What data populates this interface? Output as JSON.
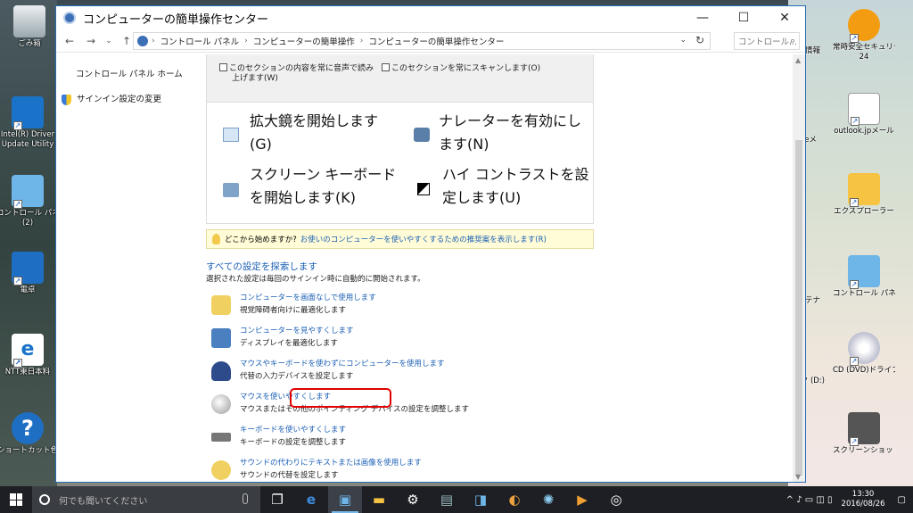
{
  "window": {
    "title": "コンピューターの簡単操作センター",
    "minimize": "—",
    "maximize": "☐",
    "close": "✕"
  },
  "addressbar": {
    "back": "←",
    "forward": "→",
    "dropdown": "⌄",
    "up": "↑",
    "crumbs": [
      "コントロール パネル",
      "コンピューターの簡単操作",
      "コンピューターの簡単操作センター"
    ],
    "sep": "›",
    "refresh": "↻",
    "search_placeholder": "コントロール...",
    "search_icon": "⌕"
  },
  "leftnav": {
    "home": "コントロール パネル ホーム",
    "signin": "サインイン設定の変更"
  },
  "options": {
    "read_aloud_line1": "このセクションの内容を常に音声で読み",
    "read_aloud_line2": "上げます(W)",
    "scan": "このセクションを常にスキャンします(O)"
  },
  "quick_tools": {
    "magnifier_l1": "拡大鏡を開始します",
    "magnifier_l2": "(G)",
    "narrator_l1": "ナレーターを有効にし",
    "narrator_l2": "ます(N)",
    "keyboard_l1": "スクリーン キーボード",
    "keyboard_l2": "を開始します(K)",
    "contrast_l1": "ハイ コントラストを設",
    "contrast_l2": "定します(U)"
  },
  "tip": {
    "prefix": "どこから始めますか?",
    "link": "お使いのコンピューターを使いやすくするための推奨案を表示します(R)"
  },
  "explore": {
    "title": "すべての設定を探索します",
    "subtitle": "選択された設定は毎回のサインイン時に自動的に開始されます。",
    "items": [
      {
        "link": "コンピューターを画面なしで使用します",
        "desc": "視覚障碍者向けに最適化します"
      },
      {
        "link": "コンピューターを見やすくします",
        "desc": "ディスプレイを最適化します"
      },
      {
        "link": "マウスやキーボードを使わずにコンピューターを使用します",
        "desc": "代替の入力デバイスを設定します"
      },
      {
        "link": "マウスを使いやすくします",
        "desc": "マウスまたはその他のポインティング デバイスの設定を調整します"
      },
      {
        "link": "キーボードを使いやすくします",
        "desc": "キーボードの設定を調整します"
      },
      {
        "link": "サウンドの代わりにテキストまたは画像を使用します",
        "desc": "サウンドの代替を設定します"
      }
    ]
  },
  "desktop_left": [
    {
      "label": "ごみ箱"
    },
    {
      "label": "Intel(R) Driver"
    },
    {
      "label": "Update Utility"
    },
    {
      "label": "コントロール パネル"
    },
    {
      "label": "(2)"
    },
    {
      "label": "電卓"
    },
    {
      "label": "NTT東日本料"
    },
    {
      "label": "ショートカット色"
    }
  ],
  "desktop_right": [
    {
      "label": "最新情報"
    },
    {
      "label": "常時安全セキュリティ"
    },
    {
      "label": "24"
    },
    {
      "label": "Liveメ"
    },
    {
      "label": "outlook.jpメール"
    },
    {
      "label": "エクスプローラー"
    },
    {
      "label": "メンテナ"
    },
    {
      "label": "コントロール パネル"
    },
    {
      "label": "イスク (D:)"
    },
    {
      "label": "CD (DVD)ドライブ (E:)"
    },
    {
      "label": "スクリーンショット"
    }
  ],
  "taskbar": {
    "search_placeholder": "何でも聞いてください",
    "apps": [
      "❐",
      "e",
      "▣",
      "▬",
      "⚙",
      "▤",
      "◨",
      "◐",
      "✺",
      "▶",
      "◎"
    ],
    "tray_icons": "^ ♪ ▭ ◫ ▯",
    "time": "13:30",
    "date": "2016/08/26",
    "notification": "▢"
  },
  "colors": {
    "link": "#1a5fb4",
    "highlight": "#e00000",
    "taskbar": "#1d1f24"
  }
}
